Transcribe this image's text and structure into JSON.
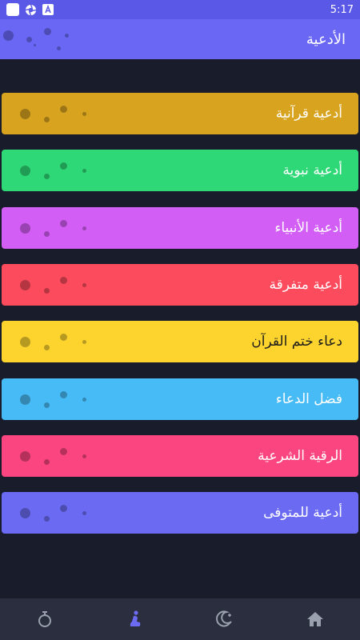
{
  "status_bar": {
    "time": "5:17"
  },
  "header": {
    "title": "الأدعية"
  },
  "cards": [
    {
      "label": "أدعية قرآنية",
      "color": "#d8a41f"
    },
    {
      "label": "أدعية نبوية",
      "color": "#2fd876"
    },
    {
      "label": "أدعية الأنبياء",
      "color": "#d35ef5"
    },
    {
      "label": "أدعية متفرقة",
      "color": "#fb4b5c"
    },
    {
      "label": "دعاء ختم القرآن",
      "color": "#fdd42e"
    },
    {
      "label": "فضل الدعاء",
      "color": "#47bbf5"
    },
    {
      "label": "الرقية الشرعية",
      "color": "#fb4580"
    },
    {
      "label": "أدعية للمتوفى",
      "color": "#6b6af3"
    }
  ],
  "bottom_nav": [
    {
      "icon": "prayer-beads-icon",
      "active": false
    },
    {
      "icon": "praying-person-icon",
      "active": true
    },
    {
      "icon": "crescent-moon-icon",
      "active": false
    },
    {
      "icon": "home-icon",
      "active": false
    }
  ],
  "colors": {
    "status_bar": "#5a58e6",
    "header": "#6a67f5",
    "background": "#191c2b",
    "nav_bar": "#2a2e3e",
    "nav_icon": "#9aa0ad",
    "nav_icon_active": "#6b6af3"
  }
}
